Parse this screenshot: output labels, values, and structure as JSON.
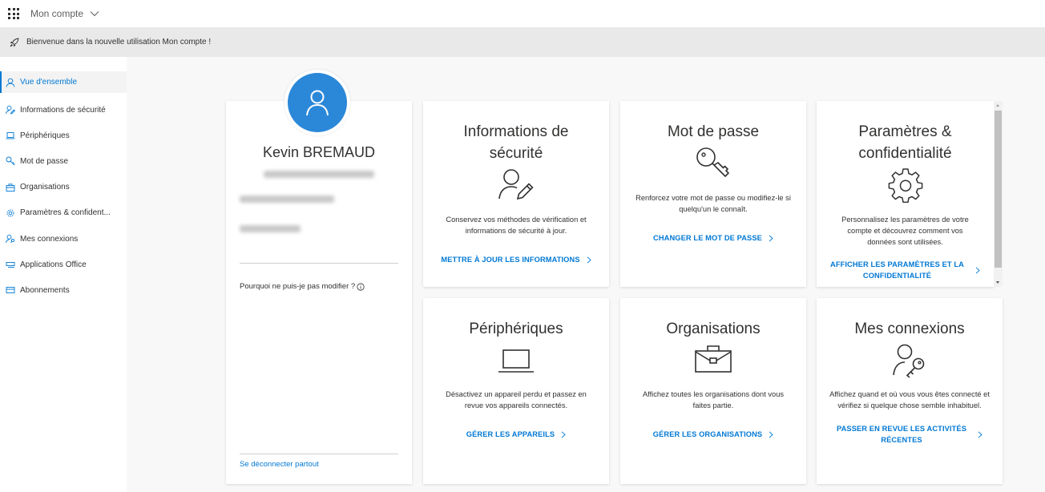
{
  "header": {
    "app_title": "Mon compte"
  },
  "banner": {
    "text": "Bienvenue dans la nouvelle utilisation Mon compte !"
  },
  "sidebar": {
    "items": [
      {
        "label": "Vue d'ensemble",
        "icon": "person-icon",
        "active": true
      },
      {
        "label": "Informations de sécurité",
        "icon": "person-edit-icon"
      },
      {
        "label": "Périphériques",
        "icon": "laptop-icon"
      },
      {
        "label": "Mot de passe",
        "icon": "key-icon"
      },
      {
        "label": "Organisations",
        "icon": "briefcase-icon"
      },
      {
        "label": "Paramètres & confident...",
        "icon": "gear-icon"
      },
      {
        "label": "Mes connexions",
        "icon": "person-key-icon"
      },
      {
        "label": "Applications Office",
        "icon": "apps-icon"
      },
      {
        "label": "Abonnements",
        "icon": "subscription-icon"
      }
    ]
  },
  "profile": {
    "name": "Kevin BREMAUD",
    "why_label": "Pourquoi ne puis-je pas modifier ?",
    "signout_label": "Se déconnecter partout"
  },
  "tiles": {
    "security": {
      "title_line1": "Informations de",
      "title_line2": "sécurité",
      "desc": "Conservez vos méthodes de vérification et informations de sécurité à jour.",
      "link": "METTRE À JOUR LES INFORMATIONS"
    },
    "password": {
      "title": "Mot de passe",
      "desc": "Renforcez votre mot de passe ou modifiez-le si quelqu'un le connaît.",
      "link": "CHANGER LE MOT DE PASSE"
    },
    "privacy": {
      "title_line1": "Paramètres &",
      "title_line2": "confidentialité",
      "desc": "Personnalisez les paramètres de votre compte et découvrez comment vos données sont utilisées.",
      "link_line1": "AFFICHER LES PARAMÈTRES ET LA",
      "link_line2": "CONFIDENTIALITÉ"
    },
    "devices": {
      "title": "Périphériques",
      "desc": "Désactivez un appareil perdu et passez en revue vos appareils connectés.",
      "link": "GÉRER LES APPAREILS"
    },
    "organizations": {
      "title": "Organisations",
      "desc": "Affichez toutes les organisations dont vous faites partie.",
      "link": "GÉRER LES ORGANISATIONS"
    },
    "signins": {
      "title": "Mes connexions",
      "desc": "Affichez quand et où vous vous êtes connecté et vérifiez si quelque chose semble inhabituel.",
      "link_line1": "PASSER EN REVUE LES ACTIVITÉS",
      "link_line2": "RÉCENTES"
    }
  },
  "colors": {
    "accent": "#0078d4",
    "avatar": "#2b88d8",
    "banner_bg": "#e9e9e9",
    "page_bg": "#f8f8f8"
  }
}
